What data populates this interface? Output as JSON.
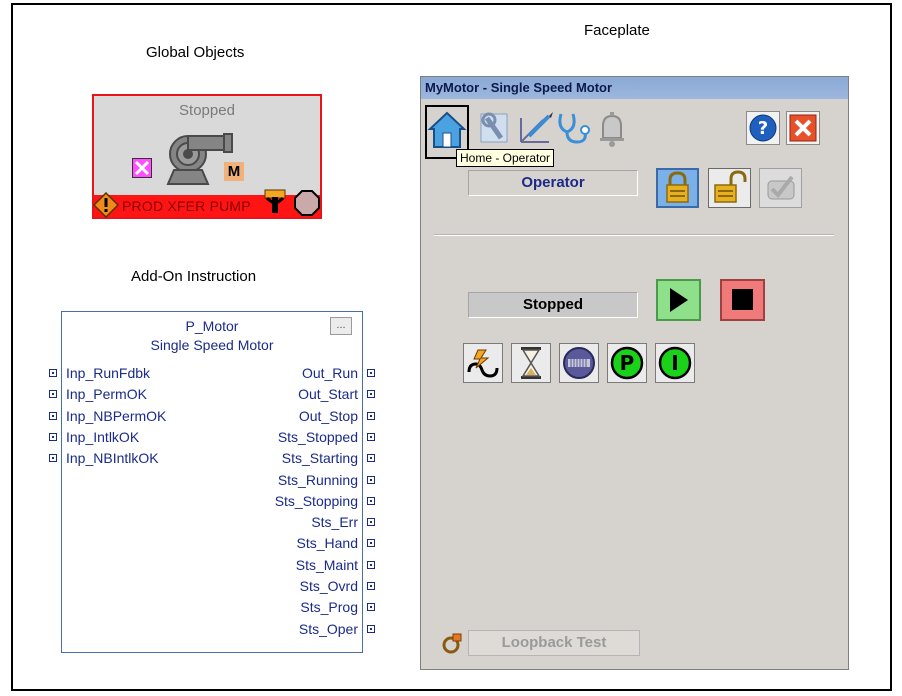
{
  "headings": {
    "global_objects": "Global Objects",
    "faceplate": "Faceplate",
    "aoi": "Add-On Instruction"
  },
  "global_object": {
    "status": "Stopped",
    "mode_letter": "M",
    "tag_label": "PROD XFER PUMP",
    "colors": {
      "border": "#e8141b",
      "bar": "#ff1414",
      "body": "#d9d9d9"
    }
  },
  "aoi": {
    "name": "P_Motor",
    "description": "Single Speed Motor",
    "ellipsis": "...",
    "inputs": [
      "Inp_RunFdbk",
      "Inp_PermOK",
      "Inp_NBPermOK",
      "Inp_IntlkOK",
      "Inp_NBIntlkOK"
    ],
    "outputs": [
      "Out_Run",
      "Out_Start",
      "Out_Stop",
      "Sts_Stopped",
      "Sts_Starting",
      "Sts_Running",
      "Sts_Stopping",
      "Sts_Err",
      "Sts_Hand",
      "Sts_Maint",
      "Sts_Ovrd",
      "Sts_Prog",
      "Sts_Oper"
    ]
  },
  "faceplate": {
    "title": "MyMotor - Single Speed Motor",
    "tooltip": "Home - Operator",
    "mode_field": "Operator",
    "state_field": "Stopped",
    "loopback_label": "Loopback Test",
    "toolbar_icons": [
      "home-icon",
      "maintenance-icon",
      "engineering-icon",
      "diagnostics-icon",
      "alarm-bell-icon",
      "help-icon",
      "close-icon"
    ],
    "lock_buttons": [
      "lock-icon",
      "unlock-icon",
      "reset-ack-icon"
    ],
    "command_buttons": [
      "start-icon",
      "stop-icon"
    ],
    "status_icons": [
      "run-feedback-icon",
      "hourglass-icon",
      "interlock-bypass-icon",
      "p-permissive-icon",
      "i-interlock-icon"
    ],
    "colors": {
      "start_bg": "#8fe08b",
      "stop_bg": "#f07a7a",
      "p_green": "#19d219",
      "i_green": "#19d219",
      "mode_text": "#1c2a86"
    }
  }
}
